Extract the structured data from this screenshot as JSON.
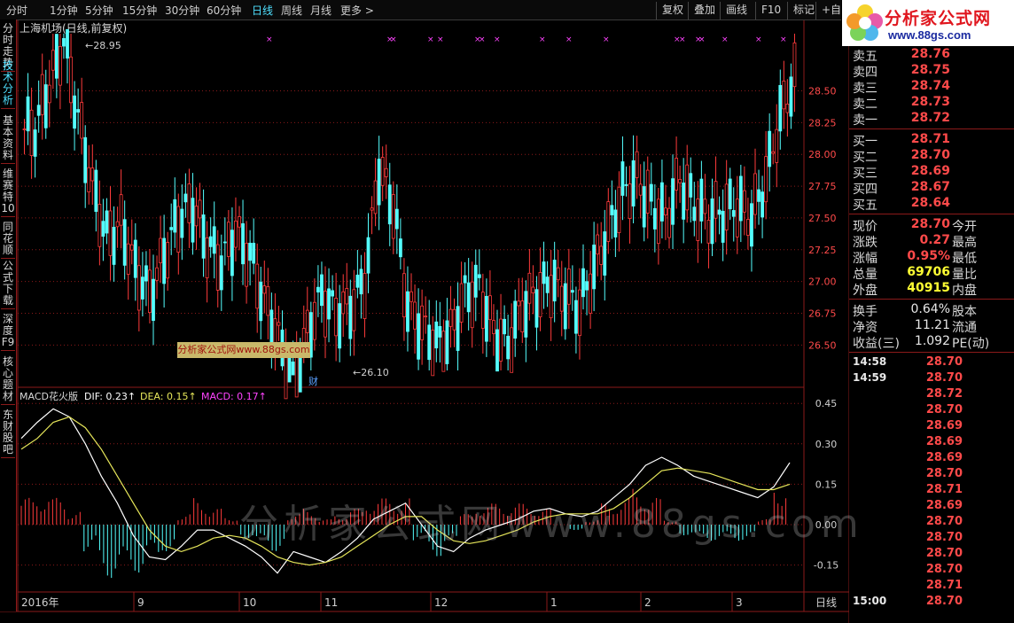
{
  "toolbar": {
    "periods": [
      "分时",
      "1分钟",
      "5分钟",
      "15分钟",
      "30分钟",
      "60分钟",
      "日线",
      "周线",
      "月线",
      "更多 >"
    ],
    "active_period": "日线",
    "buttons": [
      "复权",
      "叠加",
      "画线",
      "F10",
      "标记",
      "+自"
    ]
  },
  "sidebar_tabs": [
    "分时走势",
    "技术分析",
    "基本资料",
    "维赛特10",
    "同花顺",
    "公式下载",
    "深度F9",
    "核心题材",
    "东财股吧"
  ],
  "active_tab": "技术分析",
  "stock": {
    "title": "上海机场(日线,前复权)",
    "high_label": "28.95",
    "low_label": "26.10",
    "fin_marker": "财"
  },
  "price_axis": [
    "28.50",
    "28.25",
    "28.00",
    "27.75",
    "27.50",
    "27.25",
    "27.00",
    "26.75",
    "26.50"
  ],
  "macd_header": {
    "name": "MACD花火版",
    "dif": "DIF: 0.23",
    "dea": "DEA: 0.15",
    "macd": "MACD: 0.17"
  },
  "macd_axis": [
    "0.45",
    "0.30",
    "0.15",
    "0.00",
    "-0.15"
  ],
  "time_axis": [
    "2016年",
    "9",
    "10",
    "11",
    "12",
    "1",
    "2",
    "3"
  ],
  "period_tag": "日线",
  "logo": {
    "brand": "分析家公式网",
    "url": "www.88gs.com"
  },
  "watermark_box": "分析家公式网www.88gs.com",
  "watermark": "分析家公式网www.88gs.com",
  "colors": {
    "up": "#ff3b3b",
    "down": "#54ffff",
    "grid": "#8b1a1a",
    "dif": "#ffffff",
    "dea": "#e6e65a",
    "macd": "#ff44ff"
  },
  "quote": {
    "asks": [
      {
        "label": "卖五",
        "price": "28.76"
      },
      {
        "label": "卖四",
        "price": "28.75"
      },
      {
        "label": "卖三",
        "price": "28.74"
      },
      {
        "label": "卖二",
        "price": "28.73"
      },
      {
        "label": "卖一",
        "price": "28.72"
      }
    ],
    "bids": [
      {
        "label": "买一",
        "price": "28.71"
      },
      {
        "label": "买二",
        "price": "28.70"
      },
      {
        "label": "买三",
        "price": "28.69"
      },
      {
        "label": "买四",
        "price": "28.67"
      },
      {
        "label": "买五",
        "price": "28.64"
      }
    ],
    "stats": [
      {
        "label": "现价",
        "value": "28.70",
        "label2": "今开"
      },
      {
        "label": "涨跌",
        "value": "0.27",
        "label2": "最高"
      },
      {
        "label": "涨幅",
        "value": "0.95%",
        "label2": "最低"
      },
      {
        "label": "总量",
        "value": "69706",
        "label2": "量比"
      },
      {
        "label": "外盘",
        "value": "40915",
        "label2": "内盘"
      }
    ],
    "stats2": [
      {
        "label": "换手",
        "value": "0.64%",
        "label2": "股本"
      },
      {
        "label": "净资",
        "value": "11.21",
        "label2": "流通"
      },
      {
        "label": "收益(三)",
        "value": "1.092",
        "label2": "PE(动)"
      }
    ],
    "ticks": [
      {
        "time": "14:58",
        "price": "28.70"
      },
      {
        "time": "14:59",
        "price": "28.70"
      },
      {
        "time": "",
        "price": "28.72"
      },
      {
        "time": "",
        "price": "28.70"
      },
      {
        "time": "",
        "price": "28.69"
      },
      {
        "time": "",
        "price": "28.69"
      },
      {
        "time": "",
        "price": "28.69"
      },
      {
        "time": "",
        "price": "28.70"
      },
      {
        "time": "",
        "price": "28.71"
      },
      {
        "time": "",
        "price": "28.69"
      },
      {
        "time": "",
        "price": "28.70"
      },
      {
        "time": "",
        "price": "28.70"
      },
      {
        "time": "",
        "price": "28.70"
      },
      {
        "time": "",
        "price": "28.70"
      },
      {
        "time": "",
        "price": "28.71"
      },
      {
        "time": "15:00",
        "price": "28.70"
      }
    ]
  },
  "chart_data": {
    "type": "candlestick",
    "y_range": [
      26.3,
      28.95
    ],
    "macd_range": [
      -0.25,
      0.5
    ],
    "close_path": [
      28.2,
      28.55,
      28.9,
      28.3,
      27.75,
      27.35,
      27.45,
      27.1,
      26.9,
      27.2,
      27.5,
      27.6,
      27.3,
      27.15,
      27.4,
      27.2,
      26.85,
      26.55,
      26.2,
      26.6,
      26.9,
      26.75,
      26.8,
      27.0,
      27.9,
      27.6,
      26.8,
      26.65,
      26.5,
      26.6,
      26.9,
      26.95,
      26.6,
      26.5,
      26.8,
      26.9,
      27.0,
      26.9,
      26.8,
      27.1,
      27.4,
      27.7,
      27.8,
      27.6,
      27.5,
      27.8,
      27.6,
      27.5,
      27.55,
      27.6,
      27.5,
      27.8,
      28.3,
      28.6
    ],
    "dif": [
      0.32,
      0.38,
      0.43,
      0.4,
      0.3,
      0.18,
      0.08,
      -0.04,
      -0.12,
      -0.13,
      -0.08,
      -0.02,
      -0.02,
      -0.05,
      -0.08,
      -0.12,
      -0.18,
      -0.1,
      -0.12,
      -0.14,
      -0.1,
      -0.05,
      0.02,
      0.05,
      0.08,
      0.0,
      -0.08,
      -0.1,
      -0.05,
      -0.02,
      0.0,
      0.02,
      0.05,
      0.06,
      0.04,
      0.03,
      0.05,
      0.1,
      0.15,
      0.22,
      0.25,
      0.22,
      0.18,
      0.16,
      0.14,
      0.12,
      0.1,
      0.14,
      0.23
    ],
    "dea": [
      0.28,
      0.32,
      0.38,
      0.4,
      0.36,
      0.28,
      0.18,
      0.08,
      -0.02,
      -0.08,
      -0.1,
      -0.08,
      -0.05,
      -0.04,
      -0.05,
      -0.08,
      -0.12,
      -0.14,
      -0.15,
      -0.14,
      -0.12,
      -0.08,
      -0.04,
      0.0,
      0.03,
      0.03,
      -0.02,
      -0.06,
      -0.07,
      -0.06,
      -0.04,
      -0.02,
      0.01,
      0.03,
      0.04,
      0.04,
      0.04,
      0.06,
      0.1,
      0.15,
      0.2,
      0.21,
      0.2,
      0.19,
      0.17,
      0.15,
      0.13,
      0.13,
      0.15
    ],
    "macd": [
      0.1,
      0.12,
      0.1,
      0.05,
      -0.1,
      -0.2,
      -0.2,
      -0.18,
      -0.14,
      -0.1,
      0.04,
      0.1,
      0.06,
      0.03,
      -0.05,
      -0.08,
      -0.1,
      0.04,
      0.06,
      0.02,
      0.04,
      0.06,
      0.1,
      0.1,
      0.1,
      -0.06,
      -0.12,
      -0.08,
      0.04,
      0.08,
      0.08,
      0.08,
      0.08,
      0.06,
      0.0,
      -0.02,
      0.02,
      0.08,
      0.1,
      0.14,
      0.1,
      0.02,
      -0.04,
      -0.06,
      -0.06,
      -0.06,
      -0.06,
      0.02,
      0.17
    ]
  }
}
